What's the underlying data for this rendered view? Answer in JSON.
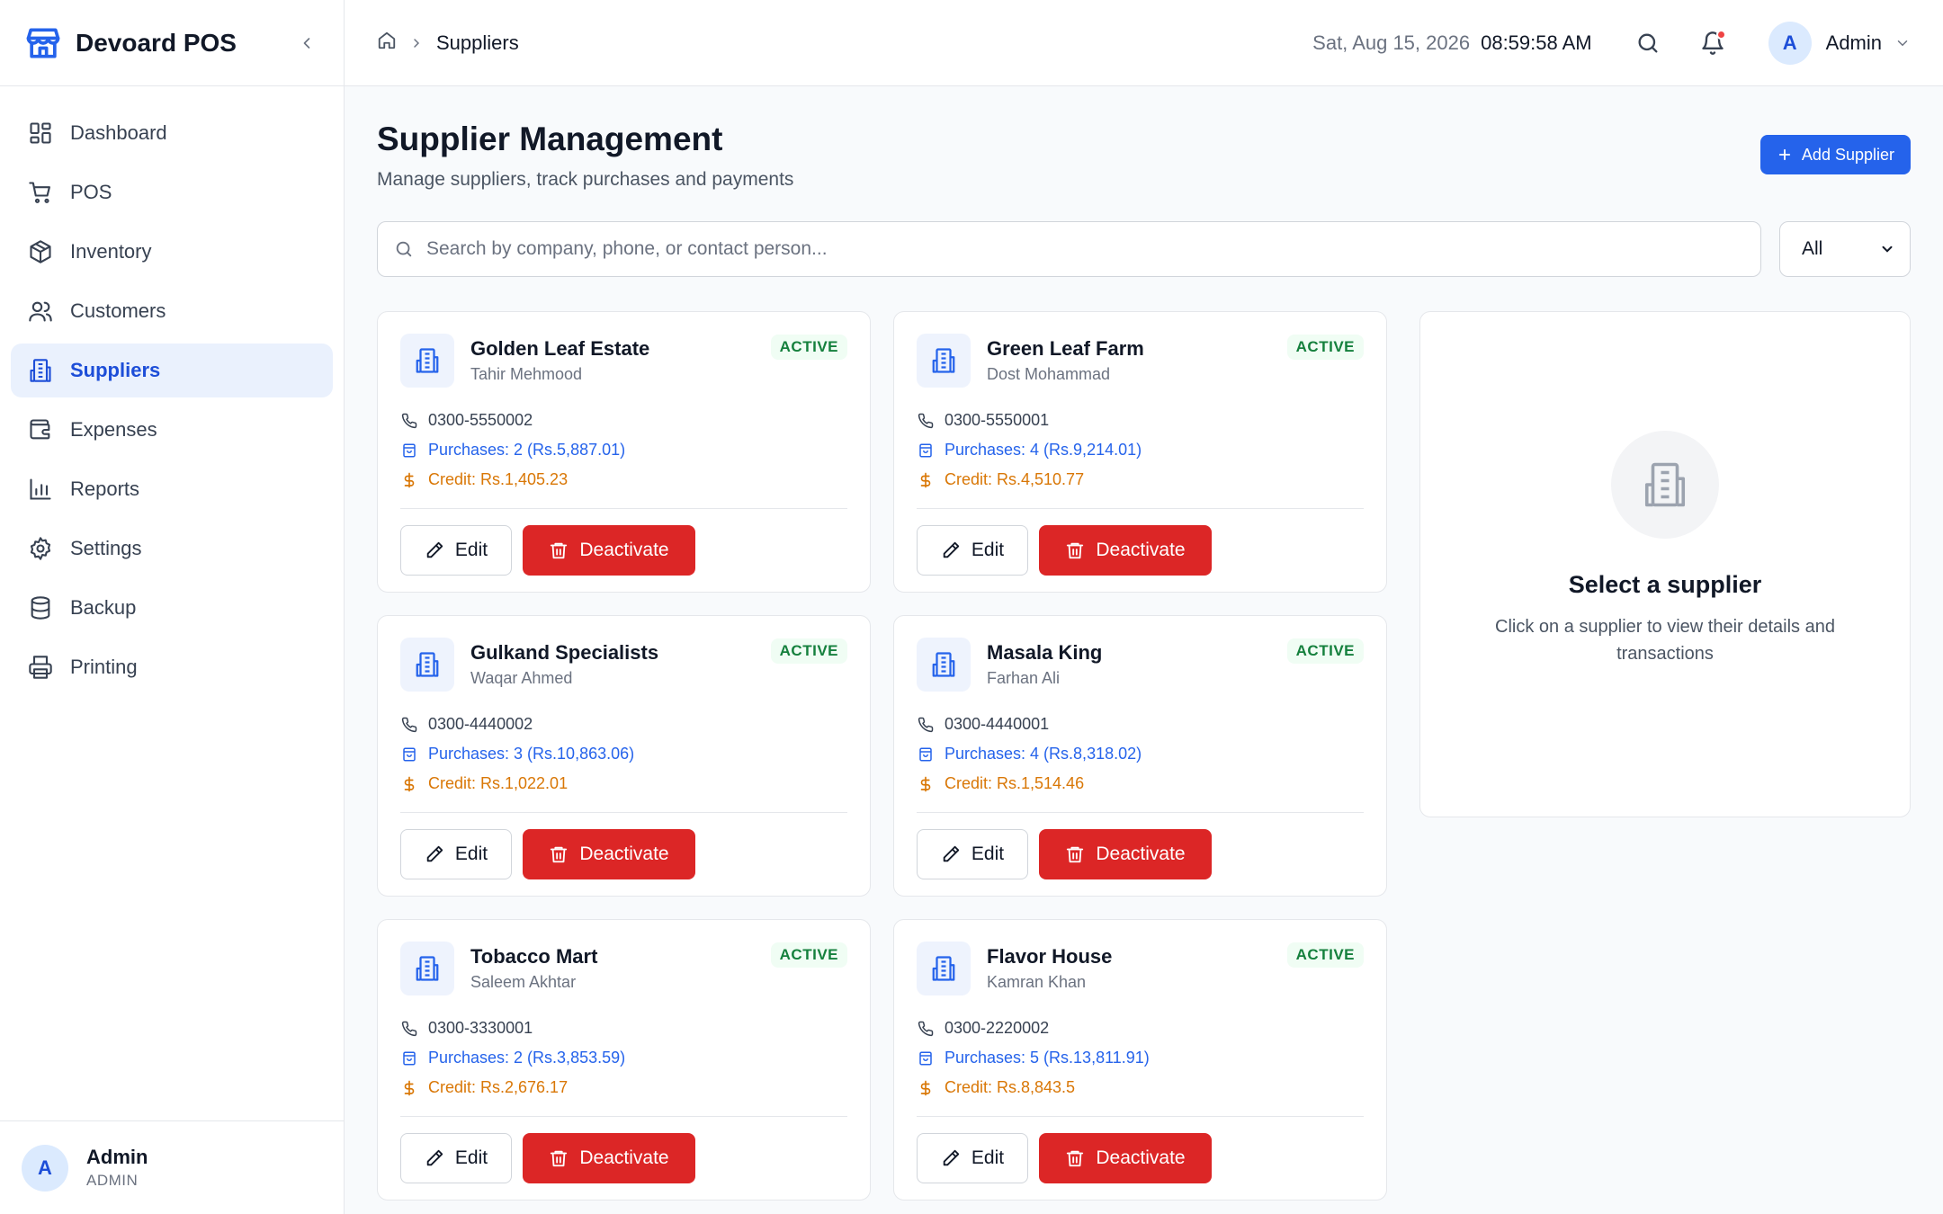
{
  "app": {
    "name": "Devoard POS"
  },
  "sidebar": {
    "items": [
      {
        "label": "Dashboard",
        "icon": "dashboard-icon",
        "active": false
      },
      {
        "label": "POS",
        "icon": "cart-icon",
        "active": false
      },
      {
        "label": "Inventory",
        "icon": "package-icon",
        "active": false
      },
      {
        "label": "Customers",
        "icon": "users-icon",
        "active": false
      },
      {
        "label": "Suppliers",
        "icon": "building-icon",
        "active": true
      },
      {
        "label": "Expenses",
        "icon": "wallet-icon",
        "active": false
      },
      {
        "label": "Reports",
        "icon": "bar-chart-icon",
        "active": false
      },
      {
        "label": "Settings",
        "icon": "gear-icon",
        "active": false
      },
      {
        "label": "Backup",
        "icon": "database-icon",
        "active": false
      },
      {
        "label": "Printing",
        "icon": "printer-icon",
        "active": false
      }
    ],
    "footer": {
      "initial": "A",
      "name": "Admin",
      "role": "ADMIN"
    }
  },
  "topbar": {
    "breadcrumb": "Suppliers",
    "date": "Sat, Aug 15, 2026",
    "time": "08:59:58 AM",
    "user": {
      "initial": "A",
      "name": "Admin"
    }
  },
  "page": {
    "title": "Supplier Management",
    "subtitle": "Manage suppliers, track purchases and payments",
    "add_button": "Add Supplier",
    "search_placeholder": "Search by company, phone, or contact person...",
    "status_filter": "All"
  },
  "suppliers": [
    {
      "company": "Golden Leaf Estate",
      "contact": "Tahir Mehmood",
      "status": "ACTIVE",
      "phone": "0300-5550002",
      "purchases": "Purchases: 2 (Rs.5,887.01)",
      "credit": "Credit: Rs.1,405.23",
      "edit_label": "Edit",
      "deactivate_label": "Deactivate"
    },
    {
      "company": "Green Leaf Farm",
      "contact": "Dost Mohammad",
      "status": "ACTIVE",
      "phone": "0300-5550001",
      "purchases": "Purchases: 4 (Rs.9,214.01)",
      "credit": "Credit: Rs.4,510.77",
      "edit_label": "Edit",
      "deactivate_label": "Deactivate"
    },
    {
      "company": "Gulkand Specialists",
      "contact": "Waqar Ahmed",
      "status": "ACTIVE",
      "phone": "0300-4440002",
      "purchases": "Purchases: 3 (Rs.10,863.06)",
      "credit": "Credit: Rs.1,022.01",
      "edit_label": "Edit",
      "deactivate_label": "Deactivate"
    },
    {
      "company": "Masala King",
      "contact": "Farhan Ali",
      "status": "ACTIVE",
      "phone": "0300-4440001",
      "purchases": "Purchases: 4 (Rs.8,318.02)",
      "credit": "Credit: Rs.1,514.46",
      "edit_label": "Edit",
      "deactivate_label": "Deactivate"
    },
    {
      "company": "Tobacco Mart",
      "contact": "Saleem Akhtar",
      "status": "ACTIVE",
      "phone": "0300-3330001",
      "purchases": "Purchases: 2 (Rs.3,853.59)",
      "credit": "Credit: Rs.2,676.17",
      "edit_label": "Edit",
      "deactivate_label": "Deactivate"
    },
    {
      "company": "Flavor House",
      "contact": "Kamran Khan",
      "status": "ACTIVE",
      "phone": "0300-2220002",
      "purchases": "Purchases: 5 (Rs.13,811.91)",
      "credit": "Credit: Rs.8,843.5",
      "edit_label": "Edit",
      "deactivate_label": "Deactivate"
    }
  ],
  "detail": {
    "title": "Select a supplier",
    "text": "Click on a supplier to view their details and transactions"
  },
  "colors": {
    "accent": "#2563eb",
    "danger": "#dc2626",
    "success": "#15803d",
    "credit": "#d97706"
  }
}
